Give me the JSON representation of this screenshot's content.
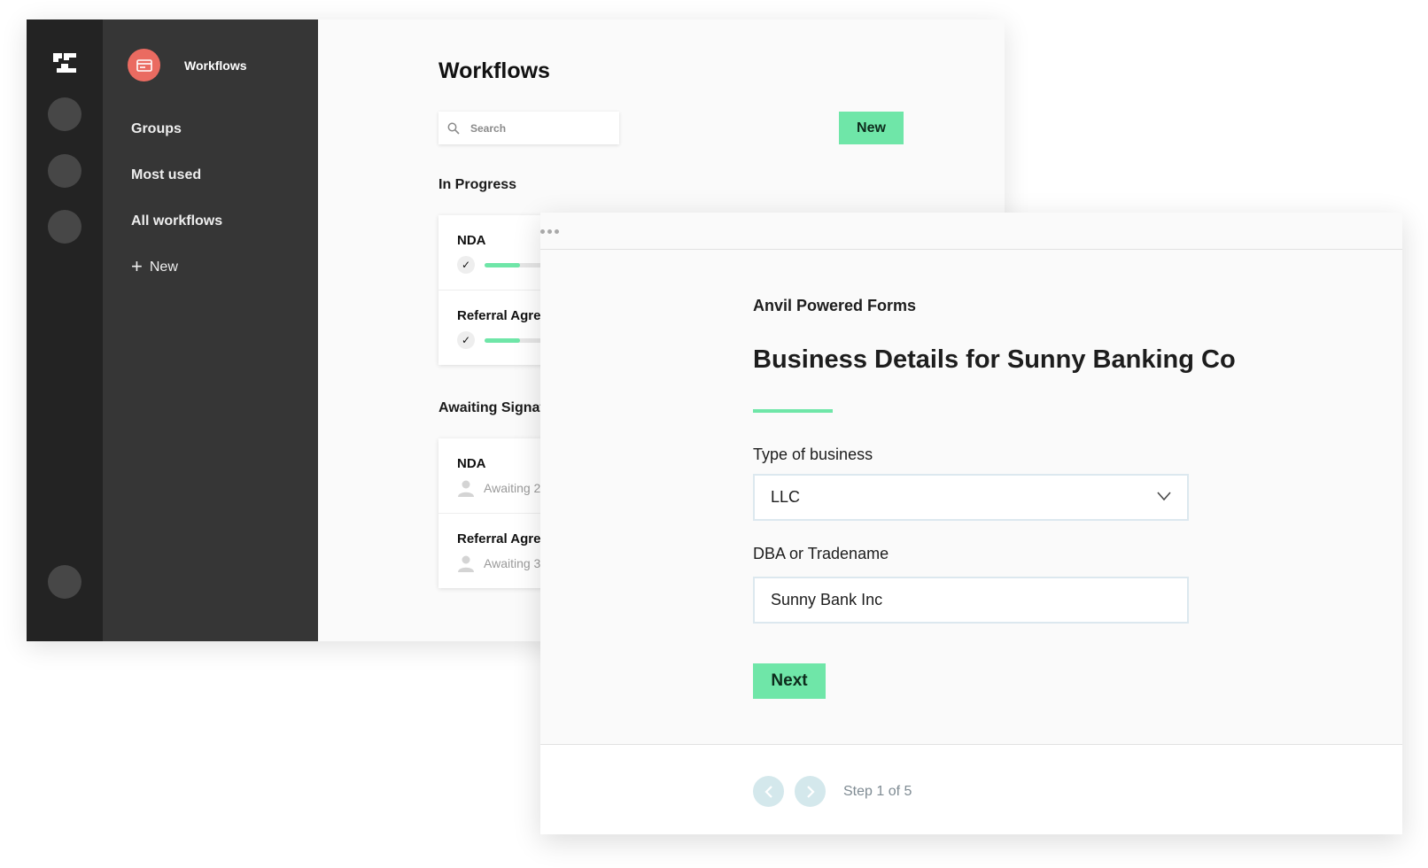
{
  "colors": {
    "accent_green": "#6fe6a8",
    "avatar_red": "#ea6b61",
    "rail_dark": "#232323",
    "sidebar_dark": "#363636",
    "field_border": "#dce8ef",
    "pager_button": "#d4e8ec"
  },
  "sidebar": {
    "app_icon": "form-icon",
    "app_title": "Workflows",
    "items": [
      {
        "label": "Groups"
      },
      {
        "label": "Most used"
      },
      {
        "label": "All workflows"
      },
      {
        "label": "New",
        "icon": "plus-icon"
      }
    ]
  },
  "main": {
    "title": "Workflows",
    "search": {
      "placeholder": "Search",
      "value": ""
    },
    "new_button": "New",
    "in_progress": {
      "label": "In Progress",
      "items": [
        {
          "title": "NDA",
          "progress": 0.18
        },
        {
          "title": "Referral Agreement",
          "progress": 0.18
        }
      ]
    },
    "awaiting": {
      "label": "Awaiting Signatures",
      "items": [
        {
          "title": "NDA",
          "status": "Awaiting 2"
        },
        {
          "title": "Referral Agreement",
          "status": "Awaiting 3"
        }
      ]
    }
  },
  "form": {
    "subtitle": "Anvil Powered Forms",
    "title": "Business Details for Sunny Banking Co",
    "fields": {
      "type_of_business": {
        "label": "Type of business",
        "value": "LLC"
      },
      "dba": {
        "label": "DBA or Tradename",
        "value": "Sunny Bank Inc"
      }
    },
    "next_button": "Next",
    "step_text": "Step 1 of 5"
  }
}
